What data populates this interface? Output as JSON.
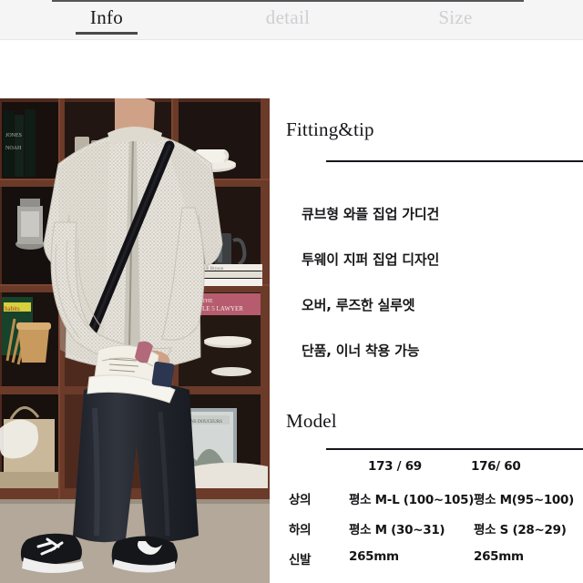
{
  "tabs": [
    {
      "label": "Info",
      "state": "active"
    },
    {
      "label": "detail",
      "state": "inactive"
    },
    {
      "label": "Size",
      "state": "inactive"
    }
  ],
  "photo": {
    "alt": "Model wearing light waffle-knit zip-up cardigan with crossbody bag in front of a dark wood bookshelf",
    "colors": {
      "shelf_wood": "#5a2f22",
      "shelf_dark": "#2a1611",
      "cardigan": "#e3e0d9",
      "pants": "#24262c",
      "floor": "#b7ada0",
      "strap": "#16161a"
    }
  },
  "fitting": {
    "heading": "Fitting&tip",
    "bullets": [
      "큐브형 와플 집업 가디건",
      "투웨이 지퍼 집업 디자인",
      "오버, 루즈한 실루엣",
      "단품, 이너 착용 가능"
    ]
  },
  "model": {
    "heading": "Model",
    "columns": [
      "173 / 69",
      "176/ 60"
    ],
    "rows": [
      {
        "label": "상의",
        "values": [
          "평소 M-L (100~105)",
          "평소 M(95~100)"
        ]
      },
      {
        "label": "하의",
        "values": [
          "평소 M (30~31)",
          "평소 S (28~29)"
        ]
      },
      {
        "label": "신발",
        "values": [
          "265mm",
          "265mm"
        ]
      }
    ]
  },
  "theme": {
    "tabbar_bg": "#f5f5f6",
    "tab_active_color": "#1a1a1a",
    "tab_inactive_color": "#cfcfd2",
    "rule_color": "#14161c",
    "text_color": "#18181b"
  }
}
